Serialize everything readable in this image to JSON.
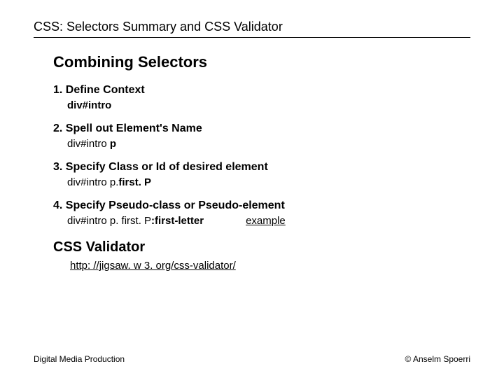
{
  "title": "CSS: Selectors Summary and CSS Validator",
  "heading1": "Combining Selectors",
  "steps": {
    "s1": {
      "title": "1. Define Context",
      "code_bold": "div#intro"
    },
    "s2": {
      "title": "2. Spell out Element's Name",
      "prefix": "div#intro ",
      "bold": "p"
    },
    "s3": {
      "title": "3. Specify Class or Id of desired element",
      "prefix": "div#intro p.",
      "bold": "first. P"
    },
    "s4": {
      "title": "4. Specify Pseudo-class or Pseudo-element",
      "prefix": "div#intro  p. first. P",
      "bold": ":first-letter",
      "example": "example"
    }
  },
  "validator": {
    "heading": "CSS Validator",
    "url": "http: //jigsaw. w 3. org/css-validator/"
  },
  "footer": {
    "left": "Digital Media Production",
    "right": "© Anselm Spoerri"
  }
}
